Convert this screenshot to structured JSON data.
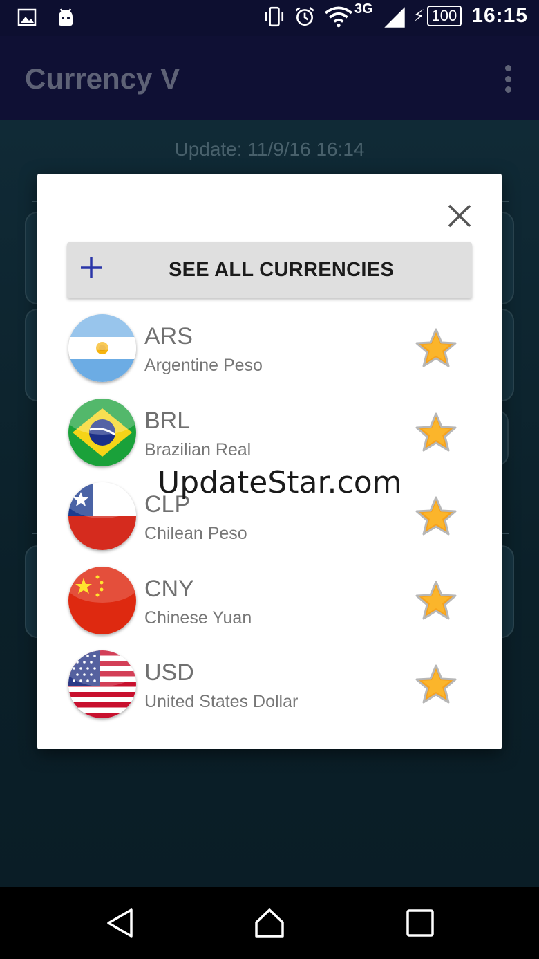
{
  "status_bar": {
    "network_type": "3G",
    "battery_level": "100",
    "time": "16:15",
    "icons": [
      "image-notification-icon",
      "android-notification-icon",
      "vibrate-icon",
      "alarm-icon",
      "wifi-icon",
      "signal-icon",
      "charging-icon"
    ]
  },
  "app_bar": {
    "title": "Currency V"
  },
  "background": {
    "update_text": "Update: 11/9/16 16:14"
  },
  "dialog": {
    "see_all_label": "SEE ALL CURRENCIES",
    "currencies": [
      {
        "code": "ARS",
        "name": "Argentine Peso",
        "flag": "argentina-flag-icon",
        "favorite": true
      },
      {
        "code": "BRL",
        "name": "Brazilian Real",
        "flag": "brazil-flag-icon",
        "favorite": true
      },
      {
        "code": "CLP",
        "name": "Chilean Peso",
        "flag": "chile-flag-icon",
        "favorite": true
      },
      {
        "code": "CNY",
        "name": "Chinese Yuan",
        "flag": "china-flag-icon",
        "favorite": true
      },
      {
        "code": "USD",
        "name": "United States Dollar",
        "flag": "usa-flag-icon",
        "favorite": true
      }
    ]
  },
  "watermark": "UpdateStar.com",
  "colors": {
    "status_bar": "#0d0f30",
    "app_bar": "#0f1034",
    "dialog_bg": "#ffffff",
    "button_bg": "#dfdfdf",
    "plus_icon": "#2a36a8",
    "star_fill": "#f7a21b"
  }
}
